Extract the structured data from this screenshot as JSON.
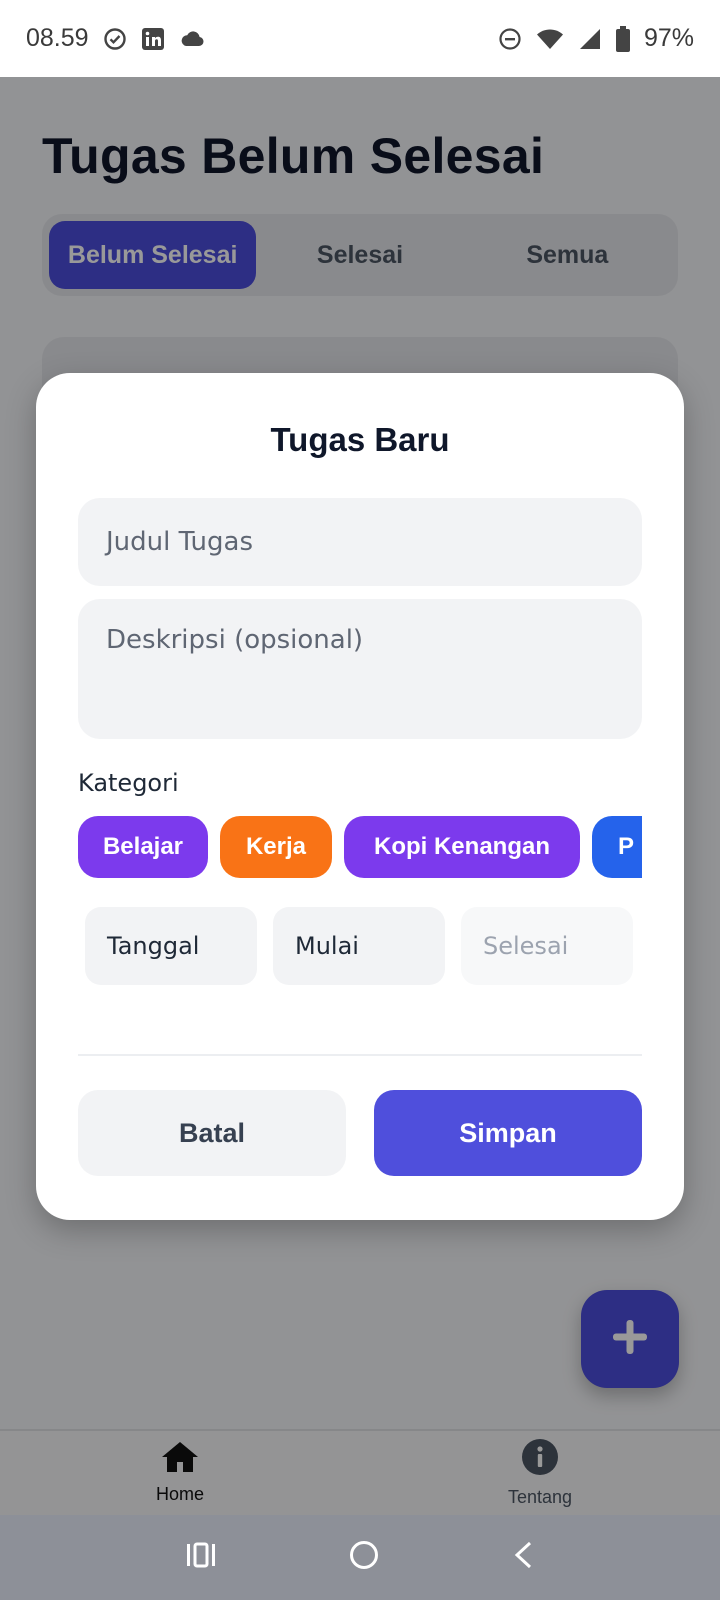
{
  "status_bar": {
    "time": "08.59",
    "battery": "97%"
  },
  "app": {
    "page_title": "Tugas Belum Selesai",
    "tabs": [
      {
        "label": "Belum Selesai",
        "active": true
      },
      {
        "label": "Selesai",
        "active": false
      },
      {
        "label": "Semua",
        "active": false
      }
    ],
    "bottom_nav": [
      {
        "label": "Home",
        "icon": "home-icon"
      },
      {
        "label": "Tentang",
        "icon": "info-icon"
      }
    ]
  },
  "modal": {
    "title": "Tugas Baru",
    "title_placeholder": "Judul Tugas",
    "description_placeholder": "Deskripsi (opsional)",
    "category_label": "Kategori",
    "categories": [
      {
        "label": "Belajar",
        "color": "#7c3aed"
      },
      {
        "label": "Kerja",
        "color": "#f97316"
      },
      {
        "label": "Kopi Kenangan",
        "color": "#7c3aed"
      },
      {
        "label": "P",
        "color": "#2563eb"
      }
    ],
    "date_label": "Tanggal",
    "start_label": "Mulai",
    "end_label": "Selesai",
    "cancel_label": "Batal",
    "save_label": "Simpan"
  },
  "colors": {
    "accent": "#4c4ddc",
    "scrim": "rgba(0,0,0,0.40)"
  }
}
